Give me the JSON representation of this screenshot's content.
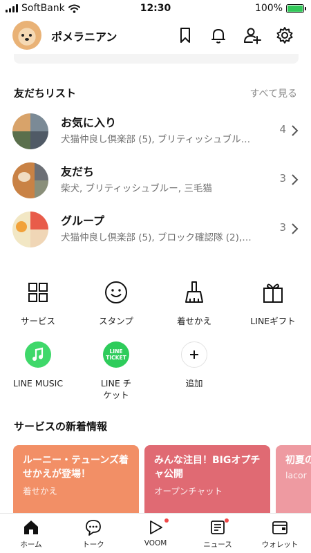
{
  "status_bar": {
    "carrier": "SoftBank",
    "time": "12:30",
    "battery": "100%"
  },
  "profile": {
    "name": "ポメラニアン",
    "icons": [
      "bookmark-icon",
      "bell-icon",
      "add-friend-icon",
      "gear-icon"
    ]
  },
  "friends": {
    "title": "友だちリスト",
    "see_all": "すべて見る",
    "rows": [
      {
        "title": "お気に入り",
        "subtitle": "犬猫仲良し倶楽部 (5), ブリティッシュブル…",
        "count": "4"
      },
      {
        "title": "友だち",
        "subtitle": "柴犬, ブリティッシュブルー, 三毛猫",
        "count": "3"
      },
      {
        "title": "グループ",
        "subtitle": "犬猫仲良し倶楽部 (5), ブロック確認隊 (2),…",
        "count": "3"
      }
    ]
  },
  "services": {
    "row1": [
      {
        "label": "サービス",
        "icon": "grid-icon"
      },
      {
        "label": "スタンプ",
        "icon": "smiley-icon"
      },
      {
        "label": "着せかえ",
        "icon": "brush-icon"
      },
      {
        "label": "LINEギフト",
        "icon": "gift-icon"
      }
    ],
    "row2": [
      {
        "label": "LINE MUSIC",
        "icon": "music-note-icon"
      },
      {
        "label_line1": "LINE チ",
        "label_line2": "ケット",
        "icon": "line-ticket-icon",
        "badge_line1": "LINE",
        "badge_line2": "TICKET"
      },
      {
        "label": "追加",
        "icon": "plus-icon"
      }
    ]
  },
  "news": {
    "title": "サービスの新着情報",
    "cards": [
      {
        "title": "ルーニー・テューンズ着せかえが登場！",
        "subtitle": "着せかえ",
        "color": "#f28f66"
      },
      {
        "title": "みんな注目！BIGオプチャ公開",
        "subtitle": "オープンチャット",
        "color": "#e06a73"
      },
      {
        "title": "初夏の",
        "subtitle": "lacor",
        "color": "#ee9aa1"
      }
    ]
  },
  "tabs": [
    {
      "label": "ホーム",
      "icon": "home-icon",
      "active": true
    },
    {
      "label": "トーク",
      "icon": "chat-icon"
    },
    {
      "label": "VOOM",
      "icon": "voom-icon",
      "badge": true
    },
    {
      "label": "ニュース",
      "icon": "news-icon",
      "badge": true
    },
    {
      "label": "ウォレット",
      "icon": "wallet-icon"
    }
  ],
  "colors": {
    "line_green": "#2ecc5b",
    "music_green": "#3fd86a",
    "badge_red": "#f04a4a"
  }
}
